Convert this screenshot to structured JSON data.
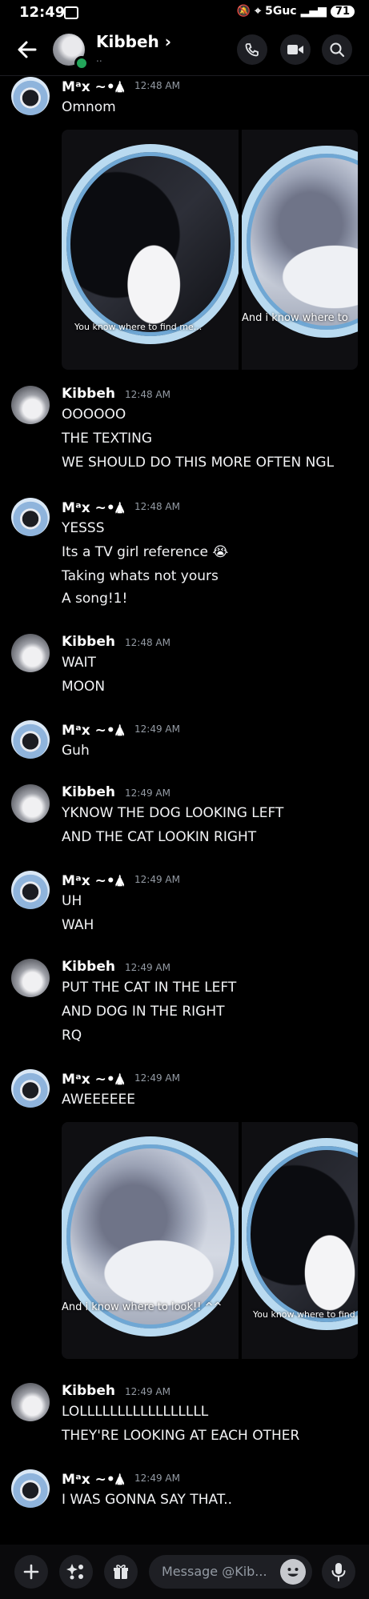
{
  "status": {
    "time": "12:49",
    "network": "5Guc",
    "battery": "71"
  },
  "header": {
    "name": "Kibbeh",
    "sub": ".."
  },
  "messages": [
    {
      "author": "Mᵃx ~•🛦",
      "time": "12:48 AM",
      "lines": [
        "Omnom"
      ]
    },
    {
      "author": "Kibbeh",
      "time": "12:48 AM",
      "lines": [
        "OOOOOO",
        "THE TEXTING",
        "WE SHOULD DO THIS MORE OFTEN NGL"
      ]
    },
    {
      "author": "Mᵃx ~•🛦",
      "time": "12:48 AM",
      "lines": [
        "YESSS",
        "Its a TV girl reference 😭",
        "Taking whats not yours",
        "A song!1!"
      ]
    },
    {
      "author": "Kibbeh",
      "time": "12:48 AM",
      "lines": [
        "WAIT",
        "MOON"
      ]
    },
    {
      "author": "Mᵃx ~•🛦",
      "time": "12:49 AM",
      "lines": [
        "Guh"
      ]
    },
    {
      "author": "Kibbeh",
      "time": "12:49 AM",
      "lines": [
        "YKNOW THE DOG LOOKING LEFT",
        "AND THE CAT LOOKIN RIGHT"
      ]
    },
    {
      "author": "Mᵃx ~•🛦",
      "time": "12:49 AM",
      "lines": [
        "UH",
        "WAH"
      ]
    },
    {
      "author": "Kibbeh",
      "time": "12:49 AM",
      "lines": [
        "PUT THE CAT IN THE LEFT",
        "AND DOG IN THE RIGHT",
        "RQ"
      ]
    },
    {
      "author": "Mᵃx ~•🛦",
      "time": "12:49 AM",
      "lines": [
        "AWEEEEEE"
      ]
    },
    {
      "author": "Kibbeh",
      "time": "12:49 AM",
      "lines": [
        "LOLLLLLLLLLLLLLLLLL",
        "THEY'RE LOOKING AT EACH OTHER"
      ]
    },
    {
      "author": "Mᵃx ~•🛦",
      "time": "12:49 AM",
      "lines": [
        "I WAS GONNA SAY THAT.."
      ]
    }
  ],
  "media": {
    "first": {
      "left_caption": "You know where to find me...",
      "right_caption": "And i know where to"
    },
    "second": {
      "left_caption": "And i know where to look!! ^^",
      "right_caption": "You know where to find m"
    }
  },
  "input": {
    "placeholder": "Message @Kib..."
  },
  "icons": {
    "back": "arrow-left-icon",
    "call": "phone-icon",
    "video": "video-camera-icon",
    "search": "search-icon",
    "plus": "plus-icon",
    "apps": "apps-icon",
    "gift": "gift-icon",
    "emoji": "emoji-icon",
    "mic": "microphone-icon"
  }
}
